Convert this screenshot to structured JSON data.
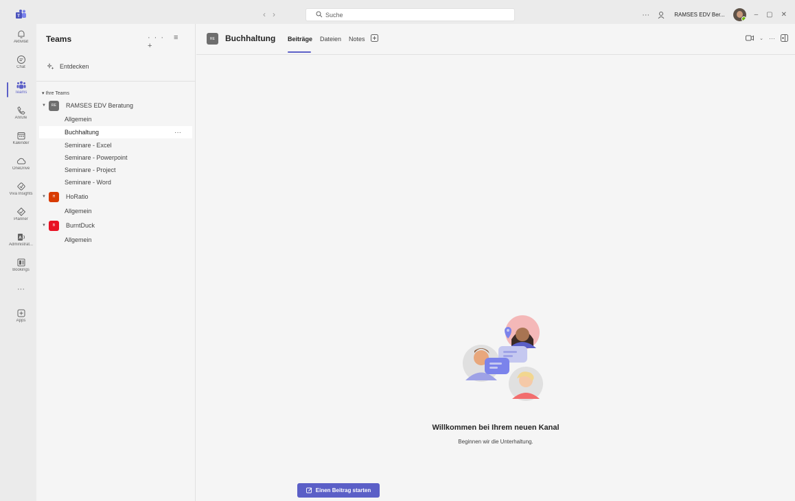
{
  "titlebar": {
    "search_placeholder": "Suche",
    "more": "···",
    "user_name": "RAMSES EDV Ber...",
    "minimize": "–",
    "maximize": "▢",
    "close": "✕"
  },
  "rail": {
    "items": [
      {
        "label": "Aktivität",
        "icon": "bell-icon"
      },
      {
        "label": "Chat",
        "icon": "chat-icon"
      },
      {
        "label": "Teams",
        "icon": "teams-icon"
      },
      {
        "label": "Anrufe",
        "icon": "phone-icon"
      },
      {
        "label": "Kalender",
        "icon": "calendar-icon"
      },
      {
        "label": "OneDrive",
        "icon": "cloud-icon"
      },
      {
        "label": "Viva Insights",
        "icon": "insights-icon"
      },
      {
        "label": "Planner",
        "icon": "planner-icon"
      },
      {
        "label": "Administrat...",
        "icon": "admin-icon"
      },
      {
        "label": "Bookings",
        "icon": "bookings-icon"
      },
      {
        "label": "···",
        "icon": "more-icon"
      },
      {
        "label": "Apps",
        "icon": "add-apps-icon"
      }
    ]
  },
  "pane": {
    "title": "Teams",
    "actions": "··· ≡ +",
    "discover": "Entdecken",
    "section": "Ihre Teams",
    "teams": [
      {
        "name": "RAMSES EDV Beratung",
        "initials": "RE",
        "color": "#6e6e6e",
        "channels": [
          "Allgemein",
          "Buchhaltung",
          "Seminare - Excel",
          "Seminare - Powerpoint",
          "Seminare - Project",
          "Seminare - Word"
        ]
      },
      {
        "name": "HoRatio",
        "initials": "H",
        "color": "#d83b01",
        "channels": [
          "Allgemein"
        ]
      },
      {
        "name": "BurntDuck",
        "initials": "B",
        "color": "#e81123",
        "channels": [
          "Allgemein"
        ]
      }
    ],
    "selected_more": "···"
  },
  "channel": {
    "initials": "RE",
    "title": "Buchhaltung",
    "tabs": [
      "Beiträge",
      "Dateien",
      "Notes"
    ],
    "active_tab": "Beiträge",
    "more": "···"
  },
  "empty_state": {
    "title": "Willkommen bei Ihrem neuen Kanal",
    "subtitle": "Beginnen wir die Unterhaltung.",
    "button": "Einen Beitrag starten"
  },
  "colors": {
    "accent": "#5b5fc7",
    "background": "#f5f5f5",
    "titlebar": "#ebebeb"
  }
}
